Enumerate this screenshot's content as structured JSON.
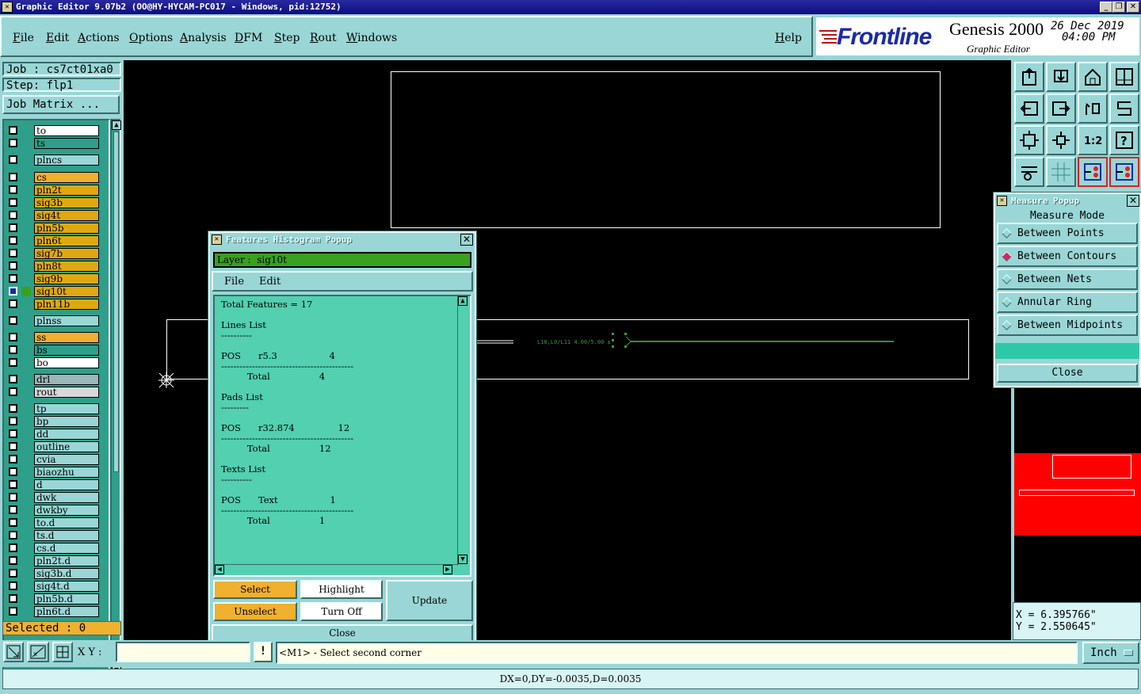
{
  "window": {
    "title": "Graphic Editor 9.07b2 (OO@HY-HYCAM-PC017 - Windows, pid:12752)"
  },
  "menu": [
    "File",
    "Edit",
    "Actions",
    "Options",
    "Analysis",
    "DFM",
    "Step",
    "Rout",
    "Windows"
  ],
  "help_label": "Help",
  "logo": {
    "brand": "Frontline",
    "product": "Genesis 2000",
    "subtitle": "Graphic Editor",
    "date": "26 Dec 2019",
    "time": "04:00 PM"
  },
  "left": {
    "job": "Job : cs7ct01xa0",
    "step": "Step: flp1",
    "job_matrix": "Job Matrix ...",
    "selected": "Selected : 0",
    "layers": [
      {
        "name": "to",
        "color": "#ffffff"
      },
      {
        "name": "ts",
        "color": "#2e9f8a"
      },
      {
        "name": "plncs",
        "color": "#9ad6d6"
      },
      {
        "name": "cs",
        "color": "#f0b030"
      },
      {
        "name": "pln2t",
        "color": "#e0a810"
      },
      {
        "name": "sig3b",
        "color": "#e0a810"
      },
      {
        "name": "sig4t",
        "color": "#e0a810"
      },
      {
        "name": "pln5b",
        "color": "#e0a810"
      },
      {
        "name": "pln6t",
        "color": "#e0a810"
      },
      {
        "name": "sig7b",
        "color": "#e0a810"
      },
      {
        "name": "pln8t",
        "color": "#e0a810"
      },
      {
        "name": "sig9b",
        "color": "#e0a810"
      },
      {
        "name": "sig10t",
        "color": "#e0a810"
      },
      {
        "name": "pln11b",
        "color": "#e0a810"
      },
      {
        "name": "plnss",
        "color": "#9ad6d6"
      },
      {
        "name": "ss",
        "color": "#f0b030"
      },
      {
        "name": "bs",
        "color": "#2e9f8a"
      },
      {
        "name": "bo",
        "color": "#ffffff"
      },
      {
        "name": "drl",
        "color": "#9ab8b8"
      },
      {
        "name": "rout",
        "color": "#d8d8d8"
      },
      {
        "name": "tp",
        "color": "#9ad6d6"
      },
      {
        "name": "bp",
        "color": "#9ad6d6"
      },
      {
        "name": "dd",
        "color": "#9ad6d6"
      },
      {
        "name": "outline",
        "color": "#9ad6d6"
      },
      {
        "name": "cvia",
        "color": "#9ad6d6"
      },
      {
        "name": "biaozhu",
        "color": "#9ad6d6"
      },
      {
        "name": "d",
        "color": "#9ad6d6"
      },
      {
        "name": "dwk",
        "color": "#9ad6d6"
      },
      {
        "name": "dwkby",
        "color": "#9ad6d6"
      },
      {
        "name": "to.d",
        "color": "#9ad6d6"
      },
      {
        "name": "ts.d",
        "color": "#9ad6d6"
      },
      {
        "name": "cs.d",
        "color": "#9ad6d6"
      },
      {
        "name": "pln2t.d",
        "color": "#9ad6d6"
      },
      {
        "name": "sig3b.d",
        "color": "#9ad6d6"
      },
      {
        "name": "sig4t.d",
        "color": "#9ad6d6"
      },
      {
        "name": "pln5b.d",
        "color": "#9ad6d6"
      },
      {
        "name": "pln6t.d",
        "color": "#9ad6d6"
      }
    ]
  },
  "canvas_text": "L10,L0/L11 4.00/5.00 ±",
  "histogram": {
    "title": "Features Histogram Popup",
    "layer_label": "Layer :  sig10t",
    "menu_file": "File",
    "menu_edit": "Edit",
    "lines": [
      "Total Features = 17",
      "",
      "Lines List",
      "----------",
      "",
      "POS      r5.3                  4",
      "-------------------------------------------",
      "         Total                 4",
      "",
      "Pads List",
      "---------",
      "",
      "POS      r32.874               12",
      "-------------------------------------------",
      "         Total                 12",
      "",
      "Texts List",
      "----------",
      "",
      "POS      Text                  1",
      "-------------------------------------------",
      "         Total                 1"
    ],
    "select": "Select",
    "highlight": "Highlight",
    "unselect": "Unselect",
    "turn_off": "Turn Off",
    "update": "Update",
    "close": "Close"
  },
  "measure": {
    "title": "Measure Popup",
    "mode_label": "Measure Mode",
    "options": [
      "Between Points",
      "Between Contours",
      "Between Nets",
      "Annular Ring",
      "Between Midpoints"
    ],
    "selected_index": 1,
    "close": "Close"
  },
  "coords": {
    "x": "X = 6.395766\"",
    "y": "Y = 2.550645\""
  },
  "bottom": {
    "xy_label": "X Y :",
    "xy_value": "",
    "prompt": "<M1> - Select second corner",
    "unit": "Inch",
    "status": "DX=0,DY=-0.0035,D=0.0035"
  }
}
